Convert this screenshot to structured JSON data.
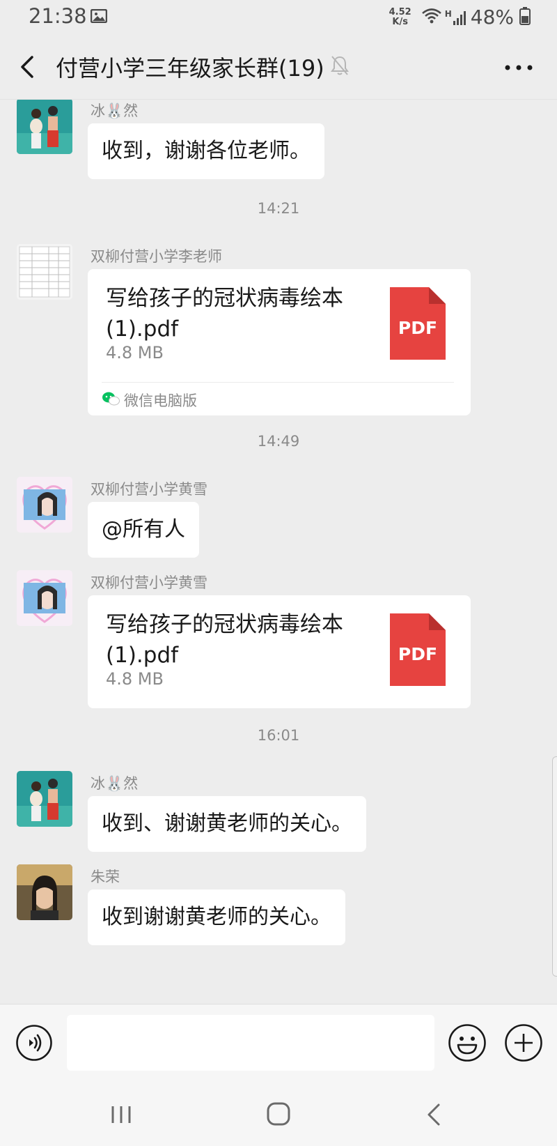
{
  "status_bar": {
    "time": "21:38",
    "network_speed_value": "4.52",
    "network_speed_unit": "K/s",
    "network_type": "H",
    "battery": "48%",
    "icons": [
      "photo-icon",
      "wifi-icon",
      "signal-icon",
      "battery-icon"
    ]
  },
  "header": {
    "title": "付营小学三年级家长群(19)",
    "muted": true,
    "icons": [
      "back-icon",
      "bell-off-icon",
      "more-icon"
    ]
  },
  "messages": [
    {
      "kind": "text",
      "sender": "冰🐰然",
      "text": "收到，谢谢各位老师。"
    },
    {
      "kind": "time",
      "text": "14:21"
    },
    {
      "kind": "file",
      "sender": "双柳付营小学李老师",
      "file_name": "写给孩子的冠状病毒绘本(1).pdf",
      "file_size": "4.8 MB",
      "file_icon_label": "PDF",
      "source": "微信电脑版"
    },
    {
      "kind": "time",
      "text": "14:49"
    },
    {
      "kind": "text",
      "sender": "双柳付营小学黄雪",
      "text": "@所有人"
    },
    {
      "kind": "file",
      "sender": "双柳付营小学黄雪",
      "file_name": "写给孩子的冠状病毒绘本(1).pdf",
      "file_size": "4.8 MB",
      "file_icon_label": "PDF"
    },
    {
      "kind": "time",
      "text": "16:01"
    },
    {
      "kind": "text",
      "sender": "冰🐰然",
      "text": "收到、谢谢黄老师的关心。"
    },
    {
      "kind": "text",
      "sender": "朱荣",
      "text": "收到谢谢黄老师的关心。"
    }
  ],
  "input_bar": {
    "value": "",
    "icons": [
      "voice-icon",
      "emoji-icon",
      "plus-icon"
    ]
  },
  "colors": {
    "background": "#ededed",
    "bubble": "#ffffff",
    "pdf_red": "#e64340",
    "wechat_green": "#07c160"
  }
}
